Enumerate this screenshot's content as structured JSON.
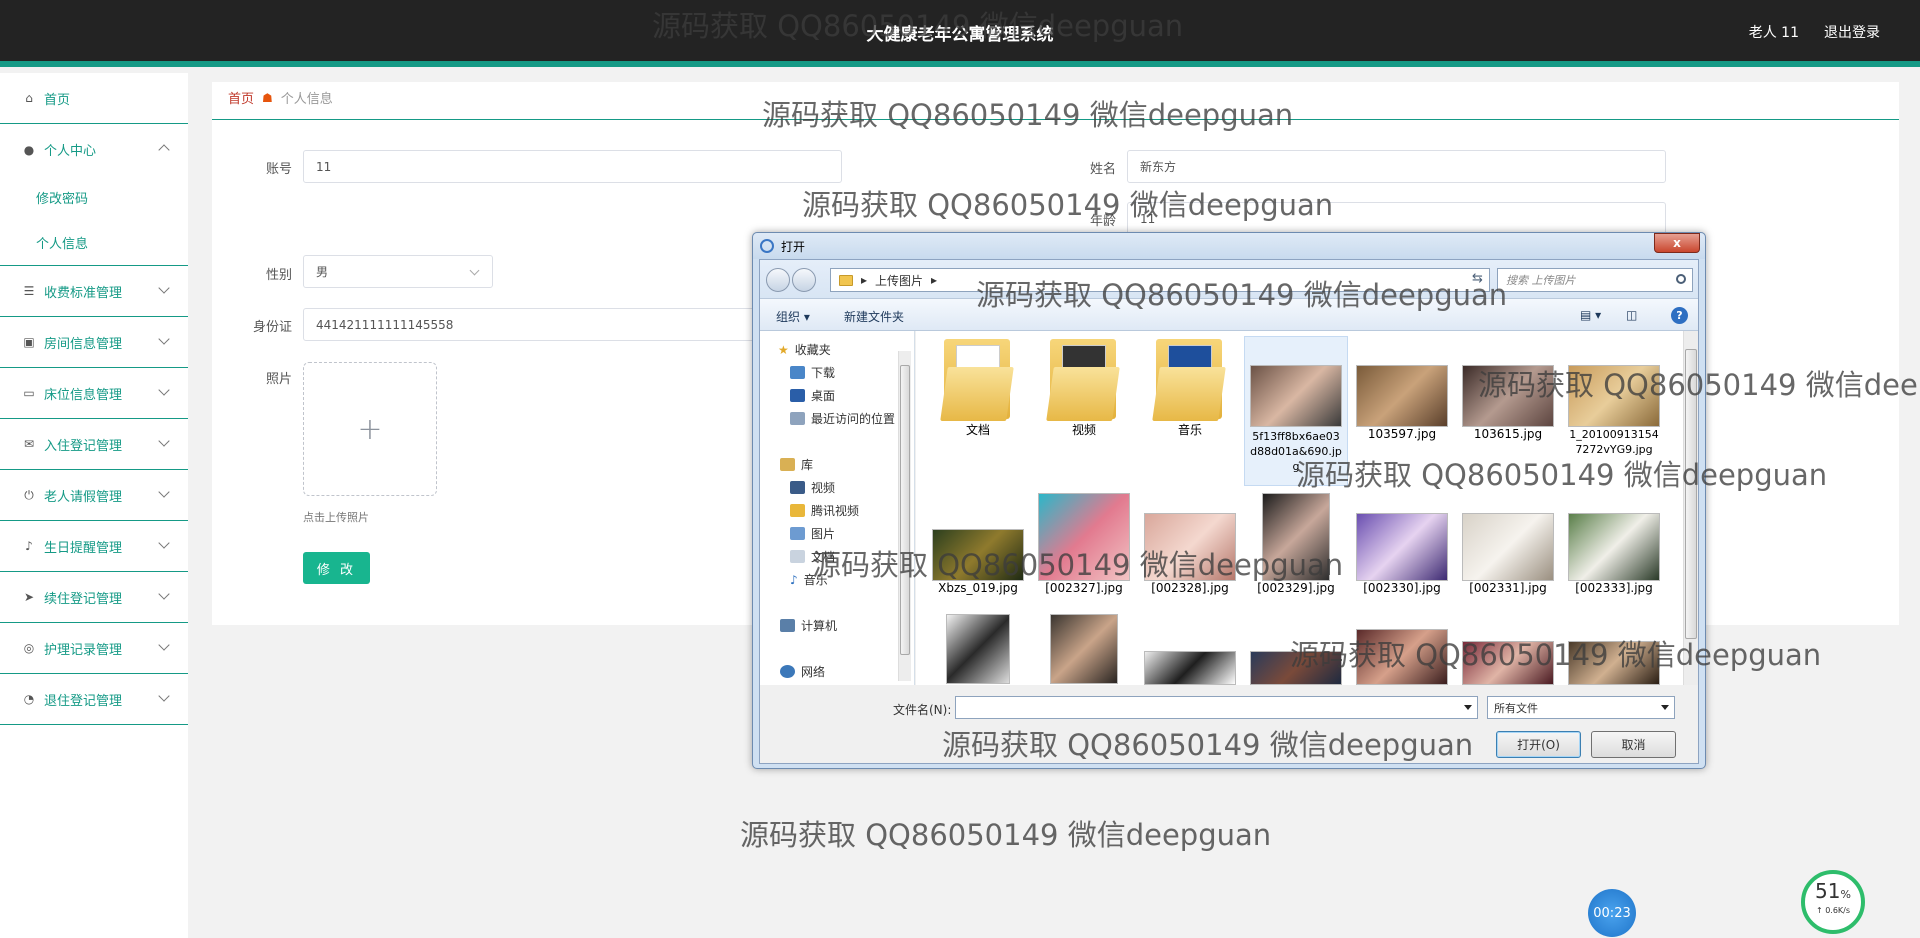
{
  "header": {
    "title": "大健康老年公寓管理系统",
    "user": "老人 11",
    "logout": "退出登录"
  },
  "sidebar": {
    "items": [
      {
        "label": "首页",
        "icon": "home-icon"
      },
      {
        "label": "个人中心",
        "icon": "user-icon"
      },
      {
        "label": "收费标准管理",
        "icon": "list-icon"
      },
      {
        "label": "房间信息管理",
        "icon": "building-icon"
      },
      {
        "label": "床位信息管理",
        "icon": "chat-icon"
      },
      {
        "label": "入住登记管理",
        "icon": "mail-icon"
      },
      {
        "label": "老人请假管理",
        "icon": "power-icon"
      },
      {
        "label": "生日提醒管理",
        "icon": "bell-icon"
      },
      {
        "label": "续住登记管理",
        "icon": "send-icon"
      },
      {
        "label": "护理记录管理",
        "icon": "compass-icon"
      },
      {
        "label": "退住登记管理",
        "icon": "gauge-icon"
      }
    ],
    "subitems": [
      "修改密码",
      "个人信息"
    ]
  },
  "breadcrumb": {
    "home": "首页",
    "current": "个人信息"
  },
  "form": {
    "account_label": "账号",
    "account_value": "11",
    "name_label": "姓名",
    "name_value": "新东方",
    "age_label": "年龄",
    "age_value": "11",
    "gender_label": "性别",
    "gender_value": "男",
    "id_label": "身份证",
    "id_value": "441421111111145558",
    "photo_label": "照片",
    "upload_plus": "+",
    "upload_hint": "点击上传照片",
    "submit": "修 改"
  },
  "dialog": {
    "title": "打开",
    "close": "x",
    "path_folder": "上传图片",
    "search_placeholder": "搜索 上传图片",
    "organize": "组织 ▾",
    "new_folder": "新建文件夹",
    "help": "?",
    "nav": {
      "favorites": "收藏夹",
      "downloads": "下载",
      "desktop": "桌面",
      "recent": "最近访问的位置",
      "libraries": "库",
      "videos": "视频",
      "tencent_video": "腾讯视频",
      "pictures": "图片",
      "documents": "文档",
      "music": "音乐",
      "computer": "计算机",
      "network": "网络"
    },
    "folders": [
      "文档",
      "视频",
      "音乐"
    ],
    "row1_files": [
      "5f13ff8bx6ae03d88d01a&690.jpg",
      "103597.jpg",
      "103615.jpg",
      "1_201009131547272vYG9.jpg"
    ],
    "row2_files": [
      "Xbzs_019.jpg",
      "[002327].jpg",
      "[002328].jpg",
      "[002329].jpg",
      "[002330].jpg",
      "[002331].jpg",
      "[002333].jpg"
    ],
    "filename_label": "文件名(N):",
    "filter": "所有文件",
    "open_button": "打开(O)",
    "cancel_button": "取消"
  },
  "watermark": "源码获取 QQ86050149 微信deepguan",
  "widgets": {
    "timer": "00:23",
    "speed_percent": "51",
    "speed_percent_unit": "%",
    "speed_rate": "↑ 0.6K/s"
  }
}
